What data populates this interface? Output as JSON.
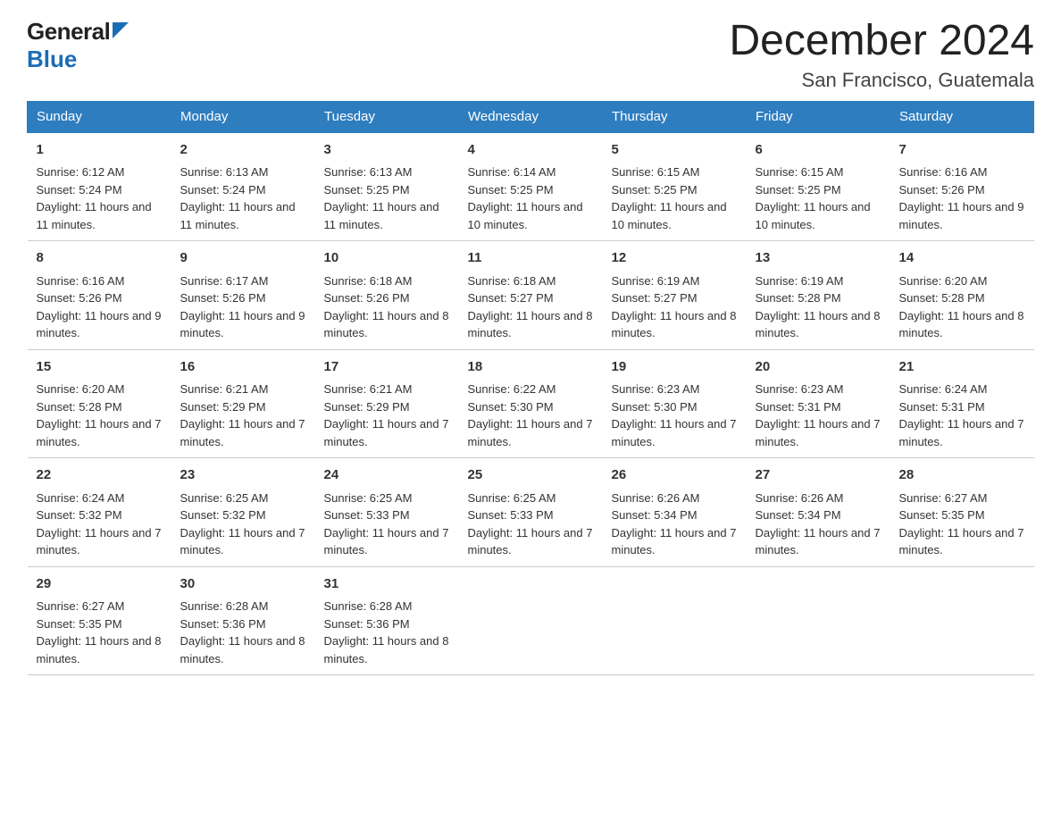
{
  "logo": {
    "general": "General",
    "blue": "Blue",
    "arrow_color": "#1a6db5"
  },
  "header": {
    "title": "December 2024",
    "subtitle": "San Francisco, Guatemala"
  },
  "days_of_week": [
    "Sunday",
    "Monday",
    "Tuesday",
    "Wednesday",
    "Thursday",
    "Friday",
    "Saturday"
  ],
  "weeks": [
    [
      {
        "day": "1",
        "sunrise": "6:12 AM",
        "sunset": "5:24 PM",
        "daylight": "11 hours and 11 minutes."
      },
      {
        "day": "2",
        "sunrise": "6:13 AM",
        "sunset": "5:24 PM",
        "daylight": "11 hours and 11 minutes."
      },
      {
        "day": "3",
        "sunrise": "6:13 AM",
        "sunset": "5:25 PM",
        "daylight": "11 hours and 11 minutes."
      },
      {
        "day": "4",
        "sunrise": "6:14 AM",
        "sunset": "5:25 PM",
        "daylight": "11 hours and 10 minutes."
      },
      {
        "day": "5",
        "sunrise": "6:15 AM",
        "sunset": "5:25 PM",
        "daylight": "11 hours and 10 minutes."
      },
      {
        "day": "6",
        "sunrise": "6:15 AM",
        "sunset": "5:25 PM",
        "daylight": "11 hours and 10 minutes."
      },
      {
        "day": "7",
        "sunrise": "6:16 AM",
        "sunset": "5:26 PM",
        "daylight": "11 hours and 9 minutes."
      }
    ],
    [
      {
        "day": "8",
        "sunrise": "6:16 AM",
        "sunset": "5:26 PM",
        "daylight": "11 hours and 9 minutes."
      },
      {
        "day": "9",
        "sunrise": "6:17 AM",
        "sunset": "5:26 PM",
        "daylight": "11 hours and 9 minutes."
      },
      {
        "day": "10",
        "sunrise": "6:18 AM",
        "sunset": "5:26 PM",
        "daylight": "11 hours and 8 minutes."
      },
      {
        "day": "11",
        "sunrise": "6:18 AM",
        "sunset": "5:27 PM",
        "daylight": "11 hours and 8 minutes."
      },
      {
        "day": "12",
        "sunrise": "6:19 AM",
        "sunset": "5:27 PM",
        "daylight": "11 hours and 8 minutes."
      },
      {
        "day": "13",
        "sunrise": "6:19 AM",
        "sunset": "5:28 PM",
        "daylight": "11 hours and 8 minutes."
      },
      {
        "day": "14",
        "sunrise": "6:20 AM",
        "sunset": "5:28 PM",
        "daylight": "11 hours and 8 minutes."
      }
    ],
    [
      {
        "day": "15",
        "sunrise": "6:20 AM",
        "sunset": "5:28 PM",
        "daylight": "11 hours and 7 minutes."
      },
      {
        "day": "16",
        "sunrise": "6:21 AM",
        "sunset": "5:29 PM",
        "daylight": "11 hours and 7 minutes."
      },
      {
        "day": "17",
        "sunrise": "6:21 AM",
        "sunset": "5:29 PM",
        "daylight": "11 hours and 7 minutes."
      },
      {
        "day": "18",
        "sunrise": "6:22 AM",
        "sunset": "5:30 PM",
        "daylight": "11 hours and 7 minutes."
      },
      {
        "day": "19",
        "sunrise": "6:23 AM",
        "sunset": "5:30 PM",
        "daylight": "11 hours and 7 minutes."
      },
      {
        "day": "20",
        "sunrise": "6:23 AM",
        "sunset": "5:31 PM",
        "daylight": "11 hours and 7 minutes."
      },
      {
        "day": "21",
        "sunrise": "6:24 AM",
        "sunset": "5:31 PM",
        "daylight": "11 hours and 7 minutes."
      }
    ],
    [
      {
        "day": "22",
        "sunrise": "6:24 AM",
        "sunset": "5:32 PM",
        "daylight": "11 hours and 7 minutes."
      },
      {
        "day": "23",
        "sunrise": "6:25 AM",
        "sunset": "5:32 PM",
        "daylight": "11 hours and 7 minutes."
      },
      {
        "day": "24",
        "sunrise": "6:25 AM",
        "sunset": "5:33 PM",
        "daylight": "11 hours and 7 minutes."
      },
      {
        "day": "25",
        "sunrise": "6:25 AM",
        "sunset": "5:33 PM",
        "daylight": "11 hours and 7 minutes."
      },
      {
        "day": "26",
        "sunrise": "6:26 AM",
        "sunset": "5:34 PM",
        "daylight": "11 hours and 7 minutes."
      },
      {
        "day": "27",
        "sunrise": "6:26 AM",
        "sunset": "5:34 PM",
        "daylight": "11 hours and 7 minutes."
      },
      {
        "day": "28",
        "sunrise": "6:27 AM",
        "sunset": "5:35 PM",
        "daylight": "11 hours and 7 minutes."
      }
    ],
    [
      {
        "day": "29",
        "sunrise": "6:27 AM",
        "sunset": "5:35 PM",
        "daylight": "11 hours and 8 minutes."
      },
      {
        "day": "30",
        "sunrise": "6:28 AM",
        "sunset": "5:36 PM",
        "daylight": "11 hours and 8 minutes."
      },
      {
        "day": "31",
        "sunrise": "6:28 AM",
        "sunset": "5:36 PM",
        "daylight": "11 hours and 8 minutes."
      },
      {
        "day": "",
        "sunrise": "",
        "sunset": "",
        "daylight": ""
      },
      {
        "day": "",
        "sunrise": "",
        "sunset": "",
        "daylight": ""
      },
      {
        "day": "",
        "sunrise": "",
        "sunset": "",
        "daylight": ""
      },
      {
        "day": "",
        "sunrise": "",
        "sunset": "",
        "daylight": ""
      }
    ]
  ]
}
